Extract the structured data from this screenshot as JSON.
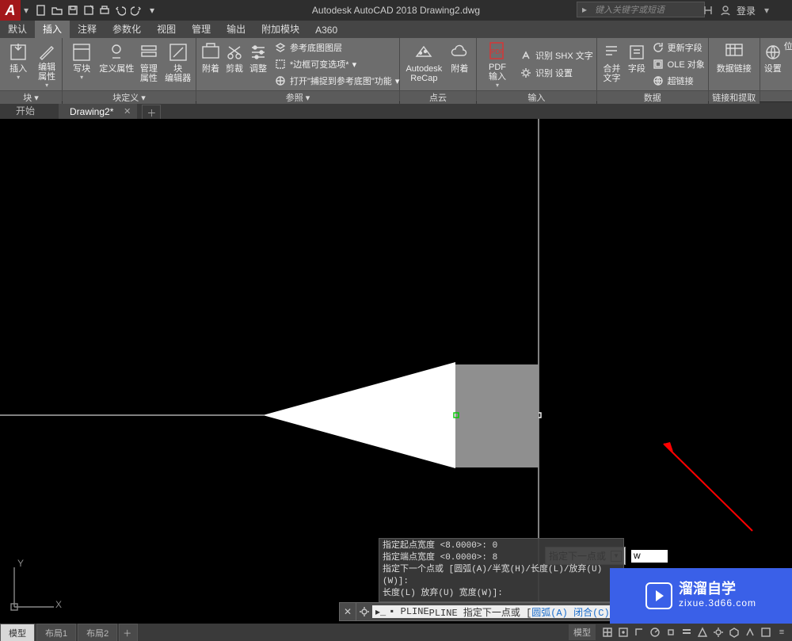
{
  "title": "Autodesk AutoCAD 2018   Drawing2.dwg",
  "search_placeholder": "键入关键字或短语",
  "login_label": "登录",
  "tabs": [
    "默认",
    "插入",
    "注释",
    "参数化",
    "视图",
    "管理",
    "输出",
    "附加模块",
    "A360"
  ],
  "active_tab_index": 1,
  "panels": {
    "block": {
      "title": "块 ▾",
      "btns": [
        "插入",
        "编辑\n属性",
        "写块",
        "定义属性",
        "管理\n属性",
        "块\n编辑器"
      ]
    },
    "blockdef": {
      "title": "块定义 ▾"
    },
    "ref": {
      "title": "参照 ▾",
      "btns": [
        "附着",
        "剪裁",
        "调整"
      ],
      "rows": [
        "参考底图图层",
        "*边框可变选项*",
        "打开\"捕捉到参考底图\"功能"
      ]
    },
    "cloud": {
      "title": "点云",
      "btns": [
        "Autodesk\nReCap",
        "附着"
      ]
    },
    "import": {
      "title": "输入",
      "btns": [
        "PDF\n输入"
      ],
      "rows": [
        "识别 SHX 文字",
        "识别 设置"
      ]
    },
    "data": {
      "title": "数据",
      "btns": [
        "合并\n文字",
        "字段"
      ],
      "rows": [
        "更新字段",
        "OLE 对象",
        "超链接"
      ]
    },
    "link": {
      "title": "链接和提取",
      "btns": [
        "数据链接"
      ]
    },
    "loc": {
      "title": "",
      "btns": [
        "设置",
        "位"
      ]
    }
  },
  "doc_tabs": {
    "start": "开始",
    "active": "Drawing2*"
  },
  "dyn_prompt": "指定下一点或",
  "dyn_value": "w",
  "cmd_history": [
    "指定起点宽度 <8.0000>: 0",
    "指定端点宽度 <0.0000>: 8",
    "指定下一个点或 [圆弧(A)/半宽(H)/长度(L)/放弃(U)",
    "(W)]:",
    "长度(L) 放弃(U) 宽度(W)]:"
  ],
  "cmd_line_prefix": "PLINE 指定下一点或 [",
  "cmd_line_opts": "圆弧(A) 闭合(C) 半宽(H",
  "watermark": {
    "cn": "溜溜自学",
    "en": "zixue.3d66.com"
  },
  "status": {
    "model": "模型",
    "layout1": "布局1",
    "layout2": "布局2",
    "rt_model": "模型"
  },
  "ucs": {
    "x": "X",
    "y": "Y"
  }
}
